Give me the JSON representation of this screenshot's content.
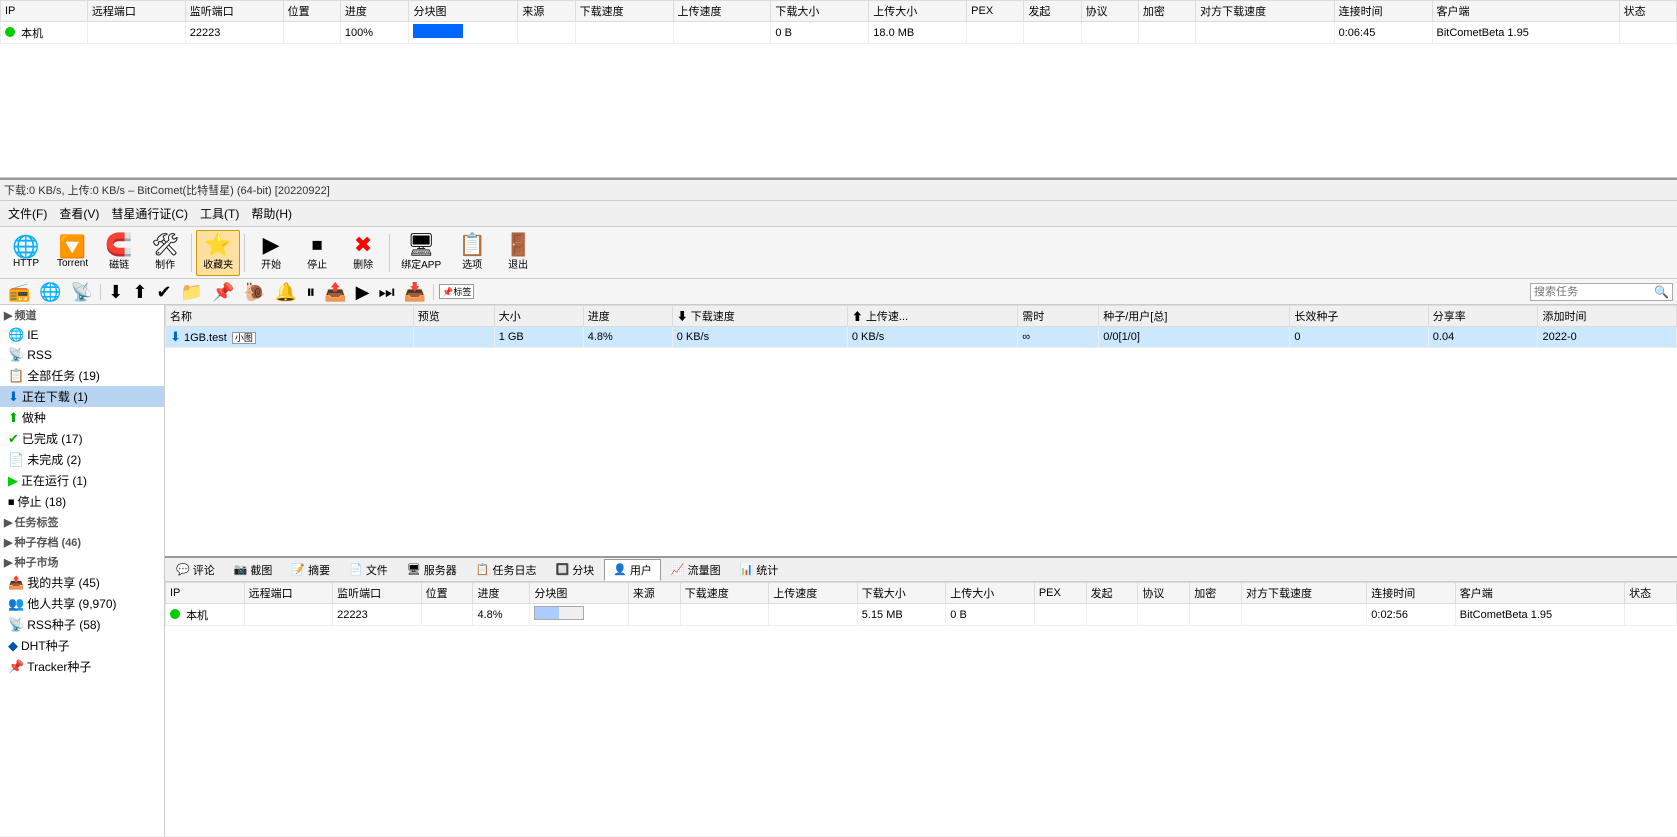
{
  "titleBar": {
    "text": "下载:0 KB/s, 上传:0 KB/s – BitComet(比特彗星) (64-bit) [20220922]"
  },
  "menuBar": {
    "items": [
      "文件(F)",
      "查看(V)",
      "彗星通行证(C)",
      "工具(T)",
      "帮助(H)"
    ]
  },
  "toolbar": {
    "buttons": [
      {
        "id": "http",
        "icon": "🌐",
        "label": "HTTP"
      },
      {
        "id": "torrent",
        "icon": "🔽",
        "label": "Torrent"
      },
      {
        "id": "magnet",
        "icon": "🧲",
        "label": "磁链"
      },
      {
        "id": "make",
        "icon": "🛠",
        "label": "制作"
      },
      {
        "id": "favorites",
        "icon": "⭐",
        "label": "收藏夹",
        "active": true
      },
      {
        "id": "start",
        "icon": "▶",
        "label": "开始"
      },
      {
        "id": "stop",
        "icon": "⏹",
        "label": "停止"
      },
      {
        "id": "delete",
        "icon": "✖",
        "label": "删除"
      },
      {
        "id": "bind-app",
        "icon": "🖥",
        "label": "绑定APP"
      },
      {
        "id": "options",
        "icon": "📋",
        "label": "选项"
      },
      {
        "id": "exit",
        "icon": "🚪",
        "label": "退出"
      }
    ]
  },
  "taskToolbar": {
    "buttons": [
      "📻",
      "IE",
      "RSS",
      "⬇",
      "⬆",
      "✔",
      "📁",
      "📌",
      "🐌",
      "🔔",
      "⏸",
      "📤",
      "▶",
      "⏭",
      "📥"
    ],
    "searchPlaceholder": "搜索任务",
    "labelTag": "📌标签"
  },
  "sidebar": {
    "sections": [
      {
        "header": "频道",
        "items": [
          {
            "label": "IE",
            "icon": "🌐"
          },
          {
            "label": "RSS",
            "icon": "📡"
          }
        ]
      },
      {
        "header": null,
        "items": [
          {
            "label": "全部任务 (19)",
            "icon": "📋"
          },
          {
            "label": "正在下载 (1)",
            "icon": "⬇",
            "selected": true
          },
          {
            "label": "做种",
            "icon": "⬆"
          },
          {
            "label": "已完成 (17)",
            "icon": "✔"
          },
          {
            "label": "未完成 (2)",
            "icon": "📄"
          },
          {
            "label": "正在运行 (1)",
            "icon": "▶"
          },
          {
            "label": "停止 (18)",
            "icon": "⏹"
          }
        ]
      },
      {
        "header": "任务标签",
        "items": []
      },
      {
        "header": "种子存档 (46)",
        "items": []
      },
      {
        "header": "种子市场",
        "items": [
          {
            "label": "我的共享 (45)",
            "icon": "📤"
          },
          {
            "label": "他人共享 (9,970)",
            "icon": "👥"
          },
          {
            "label": "RSS种子 (58)",
            "icon": "📡"
          },
          {
            "label": "DHT种子",
            "icon": "🔷"
          },
          {
            "label": "Tracker种子",
            "icon": "📌"
          }
        ]
      }
    ]
  },
  "taskList": {
    "columns": [
      "名称",
      "预览",
      "大小",
      "进度",
      "下载速度",
      "上传速... ",
      "需时",
      "种子/用户[总]",
      "长效种子",
      "分享率",
      "添加时间"
    ],
    "rows": [
      {
        "name": "1GB.test",
        "tag": "小图",
        "preview": "",
        "size": "1 GB",
        "progress": "4.8%",
        "dlSpeed": "0 KB/s",
        "ulSpeed": "0 KB/s",
        "eta": "∞",
        "seeds": "0/0[1/0]",
        "longSeeds": "0",
        "shareRatio": "0.04",
        "addTime": "2022-0"
      }
    ]
  },
  "topPeerPanel": {
    "columns": [
      "IP",
      "远程端口",
      "监听端口",
      "位置",
      "进度",
      "分块图",
      "来源",
      "下载速度",
      "上传速度",
      "下载大小",
      "上传大小",
      "PEX",
      "发起",
      "协议",
      "加密",
      "对方下载速度",
      "连接时间",
      "客户端",
      "状态"
    ],
    "rows": [
      {
        "ip": "本机",
        "remotePort": "",
        "listenPort": "22223",
        "location": "",
        "progress": "100%",
        "blockmap": "████",
        "source": "",
        "dlSpeed": "",
        "ulSpeed": "",
        "dlSize": "0 B",
        "ulSize": "18.0 MB",
        "pex": "",
        "initiated": "",
        "protocol": "",
        "encrypt": "",
        "peerDlSpeed": "",
        "connTime": "0:06:45",
        "client": "BitCometBeta 1.95",
        "status": ""
      }
    ]
  },
  "bottomPanel": {
    "tabs": [
      "评论",
      "截图",
      "摘要",
      "文件",
      "服务器",
      "任务日志",
      "分块",
      "用户",
      "流量图",
      "统计"
    ],
    "activeTab": "用户",
    "columns": [
      "IP",
      "远程端口",
      "监听端口",
      "位置",
      "进度",
      "分块图",
      "来源",
      "下载速度",
      "上传速度",
      "下载大小",
      "上传大小",
      "PEX",
      "发起",
      "协议",
      "加密",
      "对方下载速度",
      "连接时间",
      "客户端",
      "状态"
    ],
    "rows": [
      {
        "ip": "本机",
        "remotePort": "",
        "listenPort": "22223",
        "location": "",
        "progress": "4.8%",
        "blockmap": "partial",
        "source": "",
        "dlSpeed": "",
        "ulSpeed": "",
        "dlSize": "5.15 MB",
        "ulSize": "0 B",
        "pex": "",
        "initiated": "",
        "protocol": "",
        "encrypt": "",
        "peerDlSpeed": "",
        "connTime": "0:02:56",
        "client": "BitCometBeta 1.95",
        "status": ""
      }
    ]
  }
}
